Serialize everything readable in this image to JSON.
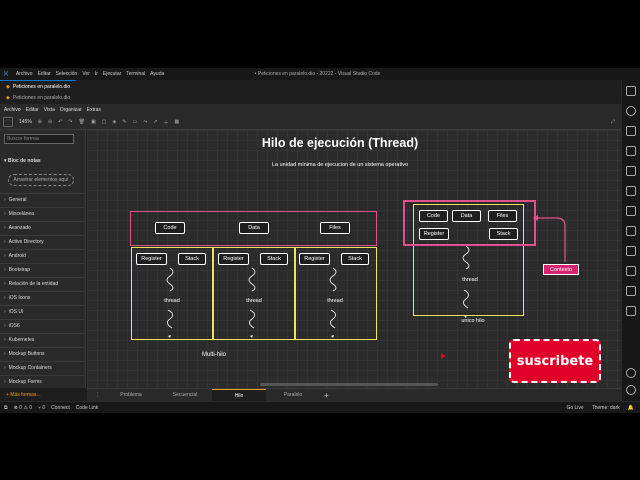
{
  "vscode": {
    "menu": [
      "Archivo",
      "Editar",
      "Selección",
      "Ver",
      "Ir",
      "Ejecutar",
      "Terminal",
      "Ayuda"
    ],
    "window_title": "• Peticiones en paralelo.dio - 20222 - Visual Studio Code",
    "tab_label": "Peticiones en paralelo.dio",
    "breadcrumb": "Peticiones en paralelo.dio"
  },
  "drawio": {
    "menu": [
      "Archivo",
      "Editar",
      "Vista",
      "Organizar",
      "Extras"
    ],
    "zoom": "145%",
    "sidebar": {
      "search_placeholder": "Buscar formas",
      "scratchpad": "Bloc de notas",
      "drop_hint": "Arrastrar elementos aquí",
      "libraries": [
        "General",
        "Miscelánea",
        "Avanzado",
        "Active Directory",
        "Android",
        "Bootstrap",
        "Relación de la entidad",
        "iOS Icons",
        "iOS UI",
        "iOS6",
        "Kubernetes",
        "Mockup Buttons",
        "Mockup Containers",
        "Mockup Forms"
      ],
      "more_shapes": "+ Más formas..."
    },
    "pages": [
      "Problema",
      "Secuencial",
      "Hilo",
      "Paralelo"
    ],
    "active_page": "Hilo",
    "add_page": "+"
  },
  "diagram": {
    "title": "Hilo de ejecución (Thread)",
    "subtitle": "La unidad mínima de ejecucion de un sistema operativo",
    "multi": {
      "resources": [
        "Code",
        "Data",
        "Files"
      ],
      "threads": [
        {
          "register": "Register",
          "stack": "Stack",
          "label": "thread"
        },
        {
          "register": "Register",
          "stack": "Stack",
          "label": "thread"
        },
        {
          "register": "Register",
          "stack": "Stack",
          "label": "thread"
        }
      ],
      "caption": "Multi-hilo"
    },
    "single": {
      "resources": [
        "Code",
        "Data",
        "Files"
      ],
      "register": "Register",
      "stack": "Stack",
      "thread": "thread",
      "caption": "unico hilo"
    },
    "context_label": "Contexto"
  },
  "status_bar": {
    "left": [
      "⊗ 0 ⚠ 0",
      "⑂ 0",
      "Connect",
      "Code Link"
    ],
    "right": [
      "Go Live",
      "Theme: dark"
    ]
  },
  "subscribe": "suscribete",
  "colors": {
    "yellow": "#f0e45a",
    "pink": "#e0508a",
    "subscribe_red": "#e0002a",
    "context_bg": "#d6246e"
  }
}
